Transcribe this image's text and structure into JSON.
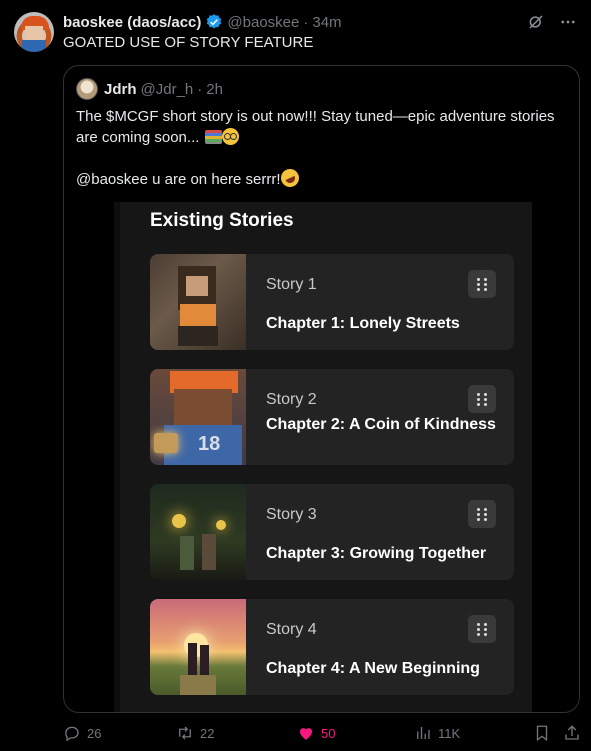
{
  "tweet": {
    "author": "baoskee (daos/acc)",
    "handle": "@baoskee",
    "separator": "·",
    "time": "34m",
    "text": "GOATED USE OF STORY FEATURE"
  },
  "quote": {
    "author": "Jdrh",
    "handle": "@Jdr_h",
    "separator": "·",
    "time": "2h",
    "line1": "The $MCGF short story is out now!!! Stay tuned—epic adventure stories are coming soon...",
    "line2": "@baoskee u are on here serrr!"
  },
  "media": {
    "title": "Existing Stories",
    "stories": [
      {
        "label": "Story 1",
        "chapter": "Chapter 1: Lonely Streets"
      },
      {
        "label": "Story 2",
        "chapter": "Chapter 2: A Coin of Kindness"
      },
      {
        "label": "Story 3",
        "chapter": "Chapter 3: Growing Together"
      },
      {
        "label": "Story 4",
        "chapter": "Chapter 4: A New Beginning"
      }
    ],
    "jersey_number": "18"
  },
  "actions": {
    "replies": "26",
    "reposts": "22",
    "likes": "50",
    "views": "11K"
  },
  "colors": {
    "background": "#000000",
    "accent_like": "#f91880",
    "verified": "#1d9bf0",
    "muted": "#71767b"
  },
  "icons": [
    "verified-badge-icon",
    "grok-icon",
    "more-icon",
    "drag-handle-icon",
    "reply-icon",
    "repost-icon",
    "like-icon",
    "views-icon",
    "bookmark-icon",
    "share-icon"
  ]
}
